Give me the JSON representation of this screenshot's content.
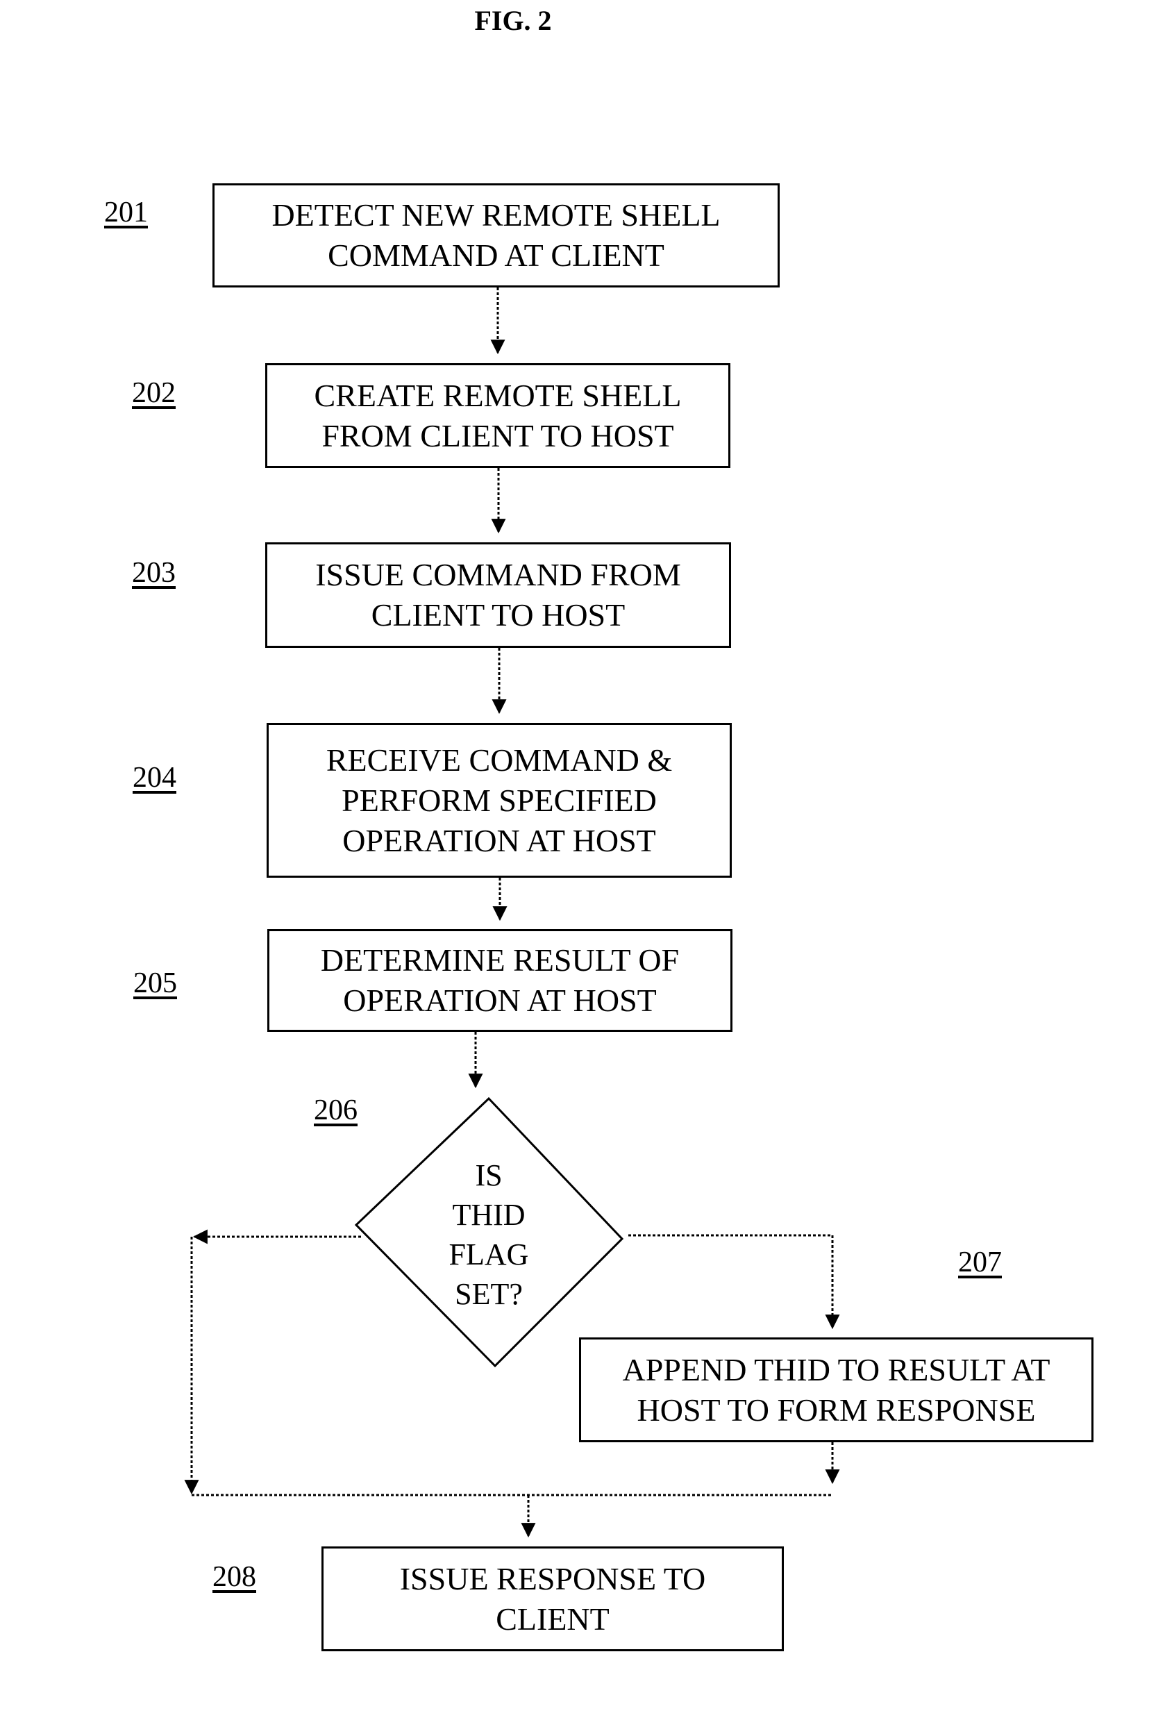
{
  "figure": {
    "title": "FIG. 2"
  },
  "steps": [
    {
      "ref": "201",
      "type": "process",
      "text": "DETECT NEW REMOTE SHELL\nCOMMAND AT CLIENT"
    },
    {
      "ref": "202",
      "type": "process",
      "text": "CREATE REMOTE SHELL\nFROM CLIENT TO HOST"
    },
    {
      "ref": "203",
      "type": "process",
      "text": "ISSUE COMMAND FROM\nCLIENT TO HOST"
    },
    {
      "ref": "204",
      "type": "process",
      "text": "RECEIVE COMMAND &\nPERFORM SPECIFIED\nOPERATION AT HOST"
    },
    {
      "ref": "205",
      "type": "process",
      "text": "DETERMINE RESULT OF\nOPERATION AT HOST"
    },
    {
      "ref": "206",
      "type": "decision",
      "text": "IS\nTHID\nFLAG\nSET?"
    },
    {
      "ref": "207",
      "type": "process",
      "text": "APPEND THID TO RESULT AT\nHOST TO FORM RESPONSE"
    },
    {
      "ref": "208",
      "type": "process",
      "text": "ISSUE RESPONSE TO\nCLIENT"
    }
  ],
  "edges": [
    {
      "from": "201",
      "to": "202",
      "style": "dotted"
    },
    {
      "from": "202",
      "to": "203",
      "style": "dotted"
    },
    {
      "from": "203",
      "to": "204",
      "style": "dotted"
    },
    {
      "from": "204",
      "to": "205",
      "style": "dotted"
    },
    {
      "from": "205",
      "to": "206",
      "style": "dotted"
    },
    {
      "from": "206",
      "to": "207",
      "style": "dotted",
      "branch": "right"
    },
    {
      "from": "206",
      "to": "208",
      "style": "dotted",
      "branch": "left"
    },
    {
      "from": "207",
      "to": "208",
      "style": "dotted"
    }
  ]
}
